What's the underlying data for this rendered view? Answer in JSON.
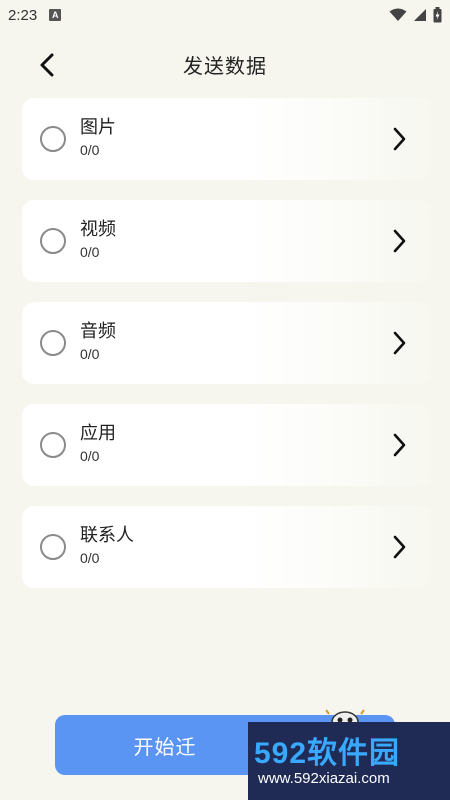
{
  "status_bar": {
    "time": "2:23",
    "app_icon_letter": "A"
  },
  "header": {
    "title": "发送数据"
  },
  "items": [
    {
      "label": "图片",
      "count": "0/0"
    },
    {
      "label": "视频",
      "count": "0/0"
    },
    {
      "label": "音频",
      "count": "0/0"
    },
    {
      "label": "应用",
      "count": "0/0"
    },
    {
      "label": "联系人",
      "count": "0/0"
    }
  ],
  "footer": {
    "start_label": "开始迁"
  },
  "watermark": {
    "main": "592软件园",
    "sub": "www.592xiazai.com"
  },
  "colors": {
    "background": "#f6f6ee",
    "accent": "#5b95f3",
    "watermark_bg": "#1f2a55",
    "watermark_text": "#38a9ff"
  },
  "icons": {
    "back": "chevron-left-icon",
    "item_arrow": "chevron-right-icon",
    "wifi": "wifi-icon",
    "signal": "signal-icon",
    "battery": "battery-icon"
  }
}
